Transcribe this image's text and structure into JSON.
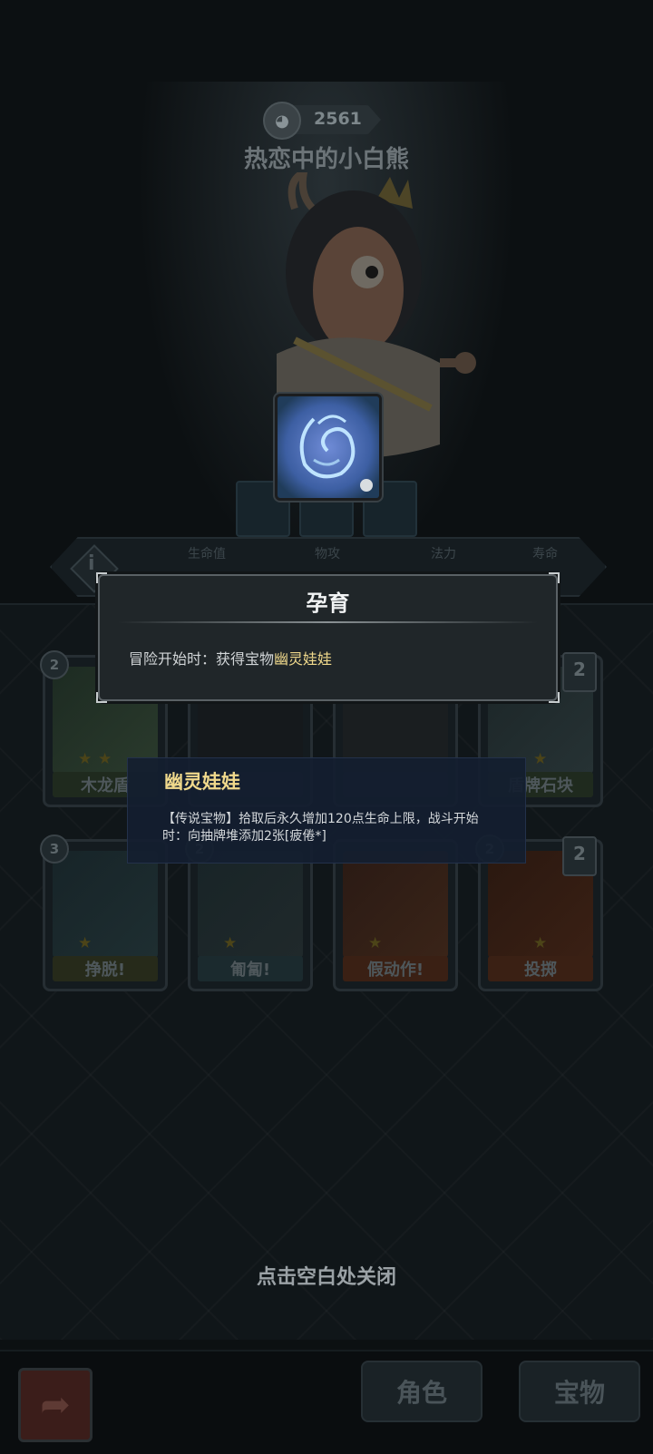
{
  "coins": {
    "value": "2561",
    "icon": "coin-icon"
  },
  "character": {
    "name": "热恋中的小白熊"
  },
  "stats": {
    "labels": [
      "生命值",
      "物攻",
      "法力",
      "寿命"
    ]
  },
  "talent_tooltip": {
    "title": "孕育",
    "desc_prefix": "冒险开始时：获得宝物",
    "desc_highlight": "幽灵娃娃"
  },
  "treasure_tooltip": {
    "name": "幽灵娃娃",
    "description": "【传说宝物】拾取后永久增加120点生命上限，战斗开始时：向抽牌堆添加2张[疲倦*]"
  },
  "cards": [
    {
      "name": "木龙盾",
      "cost": "2",
      "count": "",
      "stars": 2
    },
    {
      "name": "",
      "cost": "",
      "count": "",
      "stars": 0
    },
    {
      "name": "",
      "cost": "",
      "count": "",
      "stars": 1
    },
    {
      "name": "盾牌石块",
      "cost": "",
      "count": "2",
      "stars": 1
    },
    {
      "name": "挣脱!",
      "cost": "3",
      "count": "",
      "stars": 1
    },
    {
      "name": "匍匐!",
      "cost": "2",
      "count": "",
      "stars": 1
    },
    {
      "name": "假动作!",
      "cost": "",
      "count": "",
      "stars": 1
    },
    {
      "name": "投掷",
      "cost": "2",
      "count": "2",
      "stars": 1
    }
  ],
  "close_hint": "点击空白处关闭",
  "bottom_nav": {
    "tab_character": "角色",
    "tab_treasure": "宝物"
  },
  "colors": {
    "highlight": "#f0d98c",
    "tooltip_bg": "#202629",
    "treasure_bg": "#141e30"
  }
}
